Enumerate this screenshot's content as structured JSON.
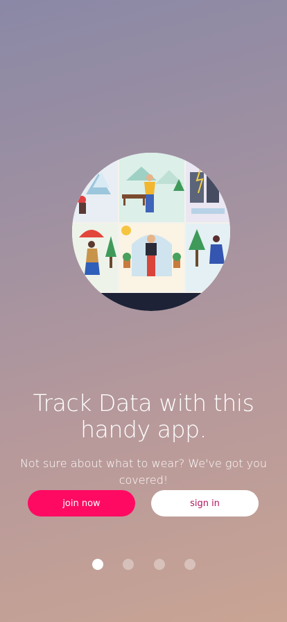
{
  "onboarding": {
    "title": "Track Data with this handy app.",
    "subtitle": "Not sure about what to wear? We've got you covered!",
    "hero_icon": "weather-people-illustration",
    "pagination": {
      "total": 4,
      "active_index": 0
    }
  },
  "actions": {
    "join_label": "join now",
    "sign_in_label": "sign in"
  },
  "colors": {
    "primary": "#ff0a63",
    "secondary_text": "#b0145f"
  }
}
